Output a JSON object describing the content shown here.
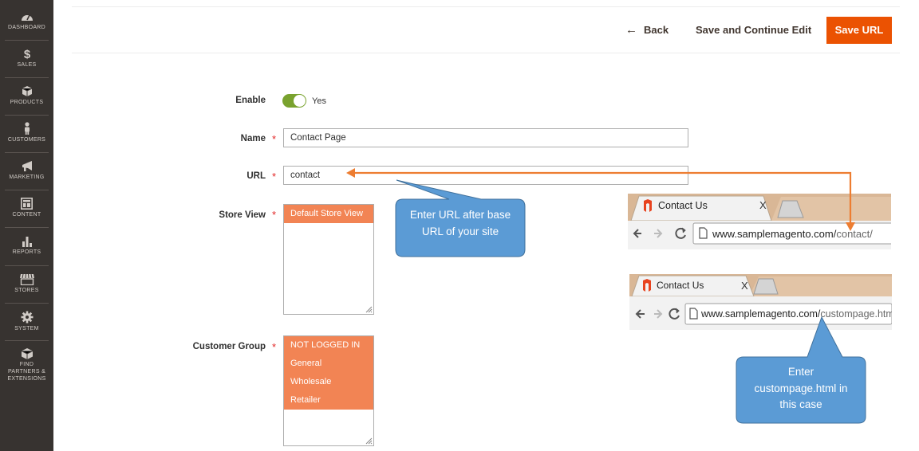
{
  "sidebar": {
    "items": [
      {
        "label": "Dashboard",
        "icon": "dashboard-icon"
      },
      {
        "label": "Sales",
        "icon": "dollar-icon"
      },
      {
        "label": "Products",
        "icon": "box-icon"
      },
      {
        "label": "Customers",
        "icon": "person-icon"
      },
      {
        "label": "Marketing",
        "icon": "megaphone-icon"
      },
      {
        "label": "Content",
        "icon": "layout-icon"
      },
      {
        "label": "Reports",
        "icon": "bar-chart-icon"
      },
      {
        "label": "Stores",
        "icon": "storefront-icon"
      },
      {
        "label": "System",
        "icon": "gear-icon"
      },
      {
        "label_lines": [
          "Find",
          "Partners &",
          "Extensions"
        ],
        "icon": "cube-icon"
      }
    ]
  },
  "header": {
    "back_label": "Back",
    "continue_label": "Save and Continue Edit",
    "save_label": "Save URL"
  },
  "form": {
    "enable": {
      "label": "Enable",
      "value": "Yes",
      "on": true
    },
    "name": {
      "label": "Name",
      "required": "*",
      "value": "Contact Page"
    },
    "url": {
      "label": "URL",
      "required": "*",
      "value": "contact"
    },
    "store_view": {
      "label": "Store View",
      "required": "*",
      "options": [
        "Default Store View"
      ]
    },
    "customer_group": {
      "label": "Customer Group",
      "required": "*",
      "options": [
        "NOT LOGGED IN",
        "General",
        "Wholesale",
        "Retailer"
      ]
    }
  },
  "callouts": {
    "url_hint": [
      "Enter URL after base",
      "URL of your site"
    ],
    "custom_hint": [
      "Enter",
      "custompage.html in",
      "this case"
    ]
  },
  "browser1": {
    "tab_title": "Contact Us",
    "close": "X",
    "url_base": "www.samplemagento.com/",
    "url_path": "contact/"
  },
  "browser2": {
    "tab_title": "Contact Us",
    "close": "X",
    "url_base": "www.samplemagento.com/",
    "url_path": "custompage.html"
  },
  "colors": {
    "sidebar": "#373330",
    "accent": "#eb5202",
    "selected_option": "#f28454",
    "toggle_on": "#79a22e",
    "callout": "#5b9bd5",
    "arrow": "#ed7d31"
  }
}
